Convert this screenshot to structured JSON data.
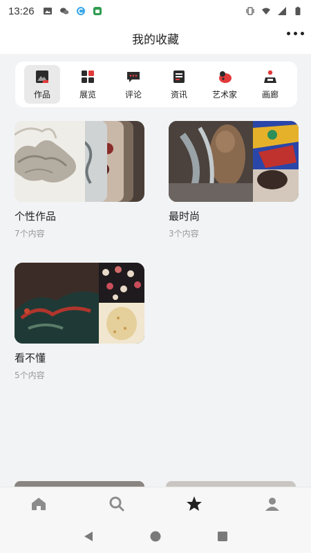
{
  "status_bar": {
    "time": "13:26",
    "notification_icons": [
      "image-icon",
      "wechat-icon",
      "c-app-icon",
      "android-app-icon"
    ],
    "system_icons": [
      "vibrate-icon",
      "wifi-icon",
      "signal-icon",
      "battery-icon"
    ]
  },
  "header": {
    "title": "我的收藏",
    "more_icon": "more-horizontal-icon"
  },
  "categories": [
    {
      "label": "作品",
      "icon": "artwork-icon",
      "active": true
    },
    {
      "label": "展览",
      "icon": "exhibition-grid-icon",
      "active": false
    },
    {
      "label": "评论",
      "icon": "comment-icon",
      "active": false
    },
    {
      "label": "资讯",
      "icon": "news-icon",
      "active": false
    },
    {
      "label": "艺术家",
      "icon": "artist-icon",
      "active": false
    },
    {
      "label": "画廊",
      "icon": "gallery-icon",
      "active": false
    }
  ],
  "collections": [
    {
      "name": "个性作品",
      "count": "7个内容"
    },
    {
      "name": "最时尚",
      "count": "3个内容"
    },
    {
      "name": "看不懂",
      "count": "5个内容"
    }
  ],
  "bottom_tabs": [
    {
      "icon": "home-icon",
      "active": false
    },
    {
      "icon": "search-icon",
      "active": false
    },
    {
      "icon": "star-icon",
      "active": true
    },
    {
      "icon": "profile-icon",
      "active": false
    }
  ],
  "colors": {
    "background": "#f2f3f5",
    "card": "#ffffff",
    "active_category": "#e9e9ea",
    "muted_text": "#999999"
  }
}
